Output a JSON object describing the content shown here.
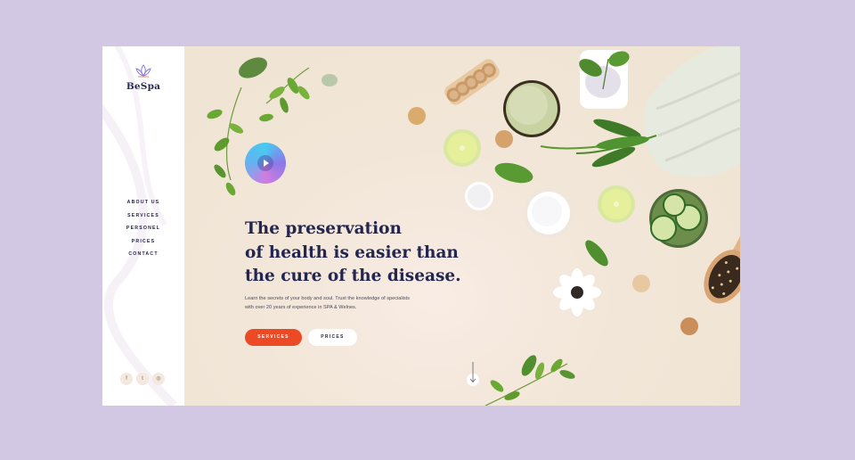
{
  "brand": {
    "name": "BeSpa"
  },
  "nav": {
    "items": [
      "ABOUT US",
      "SERVICES",
      "PERSONEL",
      "PRICES",
      "CONTACT"
    ]
  },
  "social": [
    "f",
    "t",
    "◎"
  ],
  "hero": {
    "headline": [
      "The preservation",
      "of health is easier than",
      "the cure of the disease."
    ],
    "subtext": [
      "Learn the secrets of your body and soul. Trust the knowledge of specialists",
      "with over 20 years of experience in SPA & Welnes."
    ],
    "buttons": {
      "services": "SERVICES",
      "prices": "PRICES"
    }
  },
  "colors": {
    "page_bg": "#d3c8e3",
    "accent": "#ec4a25",
    "headline": "#23264f",
    "hero_bg": "#f3ebdf"
  }
}
